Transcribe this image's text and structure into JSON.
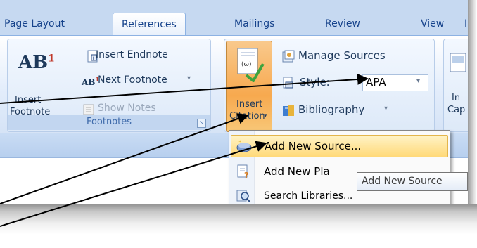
{
  "tabs": [
    {
      "label": "Page Layout",
      "active": false
    },
    {
      "label": "References",
      "active": true
    },
    {
      "label": "Mailings",
      "active": false
    },
    {
      "label": "Review",
      "active": false
    },
    {
      "label": "View",
      "active": false
    }
  ],
  "footnotes": {
    "insert_footnote_line1": "Insert",
    "insert_footnote_line2": "Footnote",
    "insert_endnote": "Insert Endnote",
    "next_footnote": "Next Footnote",
    "show_notes": "Show Notes",
    "group_label": "Footnotes"
  },
  "citations": {
    "insert_citation_line1": "Insert",
    "insert_citation_line2": "Citation",
    "manage_sources": "Manage Sources",
    "style_label": "Style:",
    "style_value": "APA",
    "bibliography": "Bibliography"
  },
  "captions": {
    "label_line1": "In",
    "label_line2": "Cap"
  },
  "menu": {
    "items": [
      {
        "label": "Add New Source...",
        "icon": "add-source-icon",
        "highlighted": true
      },
      {
        "label": "Add New Pla",
        "icon": "add-placeholder-icon",
        "highlighted": false
      },
      {
        "label": "Search Libraries...",
        "icon": "search-libraries-icon",
        "highlighted": false
      }
    ]
  },
  "tooltip": {
    "text": "Add New Source"
  },
  "colors": {
    "ribbon_blue": "#c6d9f1",
    "highlight": "#ffd978",
    "arrow": "#000000"
  }
}
